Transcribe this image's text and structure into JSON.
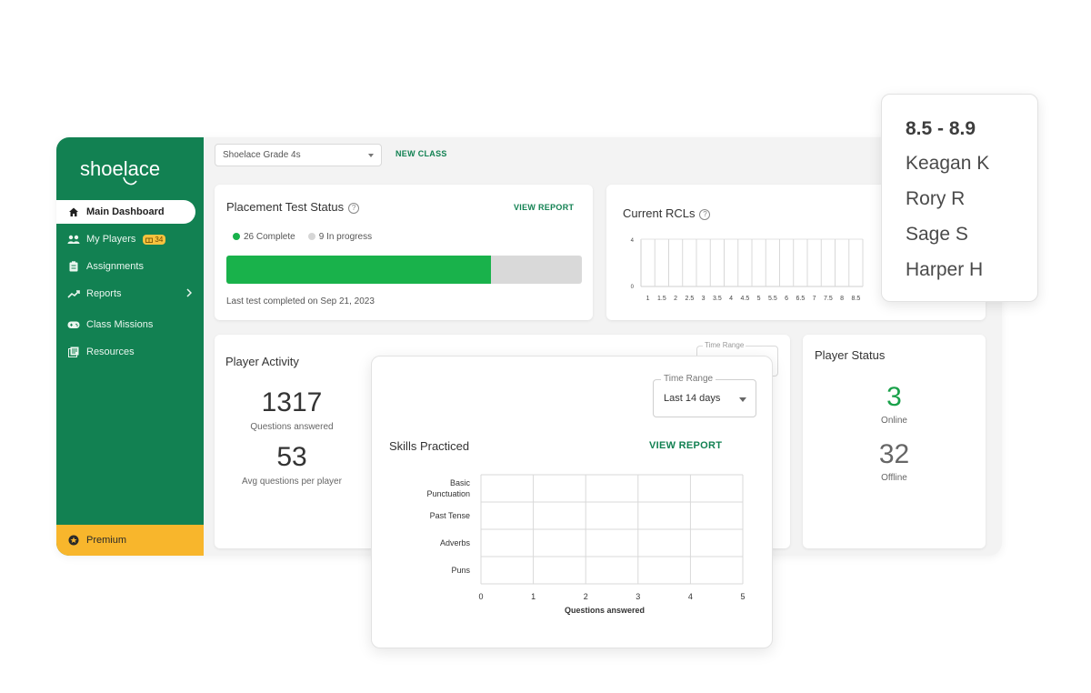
{
  "sidebar": {
    "logo_text": "shoelace",
    "items": [
      {
        "label": "Main Dashboard",
        "icon": "home-icon",
        "active": true
      },
      {
        "label": "My Players",
        "icon": "users-icon",
        "badge": "34"
      },
      {
        "label": "Assignments",
        "icon": "clipboard-icon"
      },
      {
        "label": "Reports",
        "icon": "trend-icon"
      },
      {
        "label": "Class Missions",
        "icon": "gamepad-icon"
      },
      {
        "label": "Resources",
        "icon": "library-icon"
      }
    ],
    "premium_label": "Premium"
  },
  "topbar": {
    "class_select": "Shoelace Grade 4s",
    "new_class_label": "NEW CLASS"
  },
  "placement": {
    "title": "Placement Test Status",
    "view_report": "VIEW REPORT",
    "complete_label": "26 Complete",
    "progress_label": "9 In progress",
    "complete_fraction": 0.743,
    "last_test": "Last test completed on Sep 21, 2023"
  },
  "rcl": {
    "title": "Current RCLs",
    "chart_data": {
      "type": "bar",
      "categories": [
        "1",
        "1.5",
        "2",
        "2.5",
        "3",
        "3.5",
        "4",
        "4.5",
        "5",
        "5.5",
        "6",
        "6.5",
        "7",
        "7.5",
        "8",
        "8.5"
      ],
      "values": [
        0,
        0,
        0,
        0,
        0,
        0,
        0,
        0,
        0,
        0,
        0,
        0,
        0,
        0,
        0,
        0
      ],
      "ylim": [
        0,
        4
      ],
      "yticks": [
        "4",
        "0"
      ]
    }
  },
  "activity": {
    "title": "Player Activity",
    "questions_value": "1317",
    "questions_label": "Questions answered",
    "avg_value": "53",
    "avg_label": "Avg questions per player",
    "ghost_time_range": "Time Range"
  },
  "status": {
    "title": "Player Status",
    "online_value": "3",
    "online_label": "Online",
    "offline_value": "32",
    "offline_label": "Offline"
  },
  "rcl_popup": {
    "range": "8.5 - 8.9",
    "names": [
      "Keagan K",
      "Rory R",
      "Sage S",
      "Harper H"
    ]
  },
  "skills": {
    "time_range_label": "Time Range",
    "time_range_value": "Last 14 days",
    "title": "Skills Practiced",
    "view_report": "VIEW REPORT",
    "chart_data": {
      "type": "bar",
      "orientation": "horizontal",
      "categories": [
        "Basic Punctuation",
        "Past Tense",
        "Adverbs",
        "Puns"
      ],
      "category_lines": [
        [
          "Basic",
          "Punctuation"
        ],
        [
          "Past Tense"
        ],
        [
          "Adverbs"
        ],
        [
          "Puns"
        ]
      ],
      "values": [
        0,
        0,
        0,
        0
      ],
      "xlim": [
        0,
        5
      ],
      "xticks": [
        "0",
        "1",
        "2",
        "3",
        "4",
        "5"
      ],
      "xlabel": "Questions answered"
    }
  },
  "colors": {
    "brand_green": "#128152",
    "bar_green": "#19b24b",
    "premium_yellow": "#f8b62c",
    "online_green": "#19a14a"
  }
}
